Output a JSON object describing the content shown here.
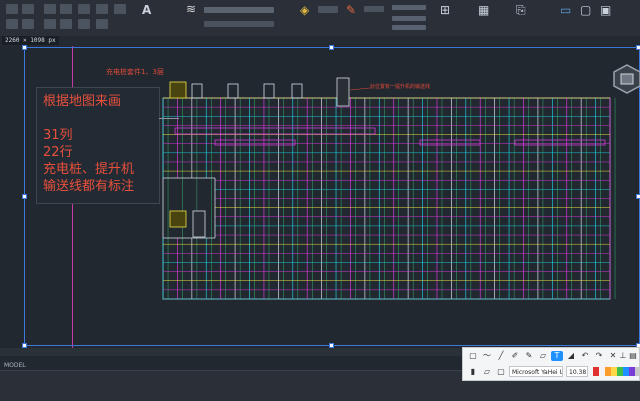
{
  "canvas": {
    "dimension_readout": "2260 × 1098 px",
    "annotation": {
      "lines": [
        "根据地图来画",
        "",
        "31列",
        "22行",
        "充电桩、提升机",
        "输送线都有标注"
      ]
    },
    "callouts": {
      "charger_pair": "充电桩套件1、3层",
      "top_right_note": "此位置有一提升机的输送线"
    }
  },
  "status": {
    "model_tab": "MODEL"
  },
  "text_toolbar": {
    "font_family": "Microsoft YaHei UI",
    "font_size": "10.38",
    "swatches": [
      "#e03030",
      "#f3f3f3",
      "#ff9c2a",
      "#ffd84a",
      "#3fbf4a",
      "#1e90ff",
      "#7a3cd8",
      "#c8c8c8"
    ],
    "tools": [
      "select-icon",
      "pen-icon",
      "line-icon",
      "brush-icon",
      "marker-icon",
      "text-icon",
      "eraser-icon",
      "undo-icon",
      "redo-icon",
      "close-icon",
      "pin-icon",
      "copy-icon",
      "save-icon"
    ]
  },
  "colors": {
    "rack_cyan": "#1fc8d8",
    "rack_magenta": "#d23ad8",
    "rack_green": "#39d27a",
    "rack_white": "#d8dde6",
    "rack_yellow": "#f0e040",
    "selection": "#3e78d8",
    "annotation_red": "#e8503c"
  }
}
